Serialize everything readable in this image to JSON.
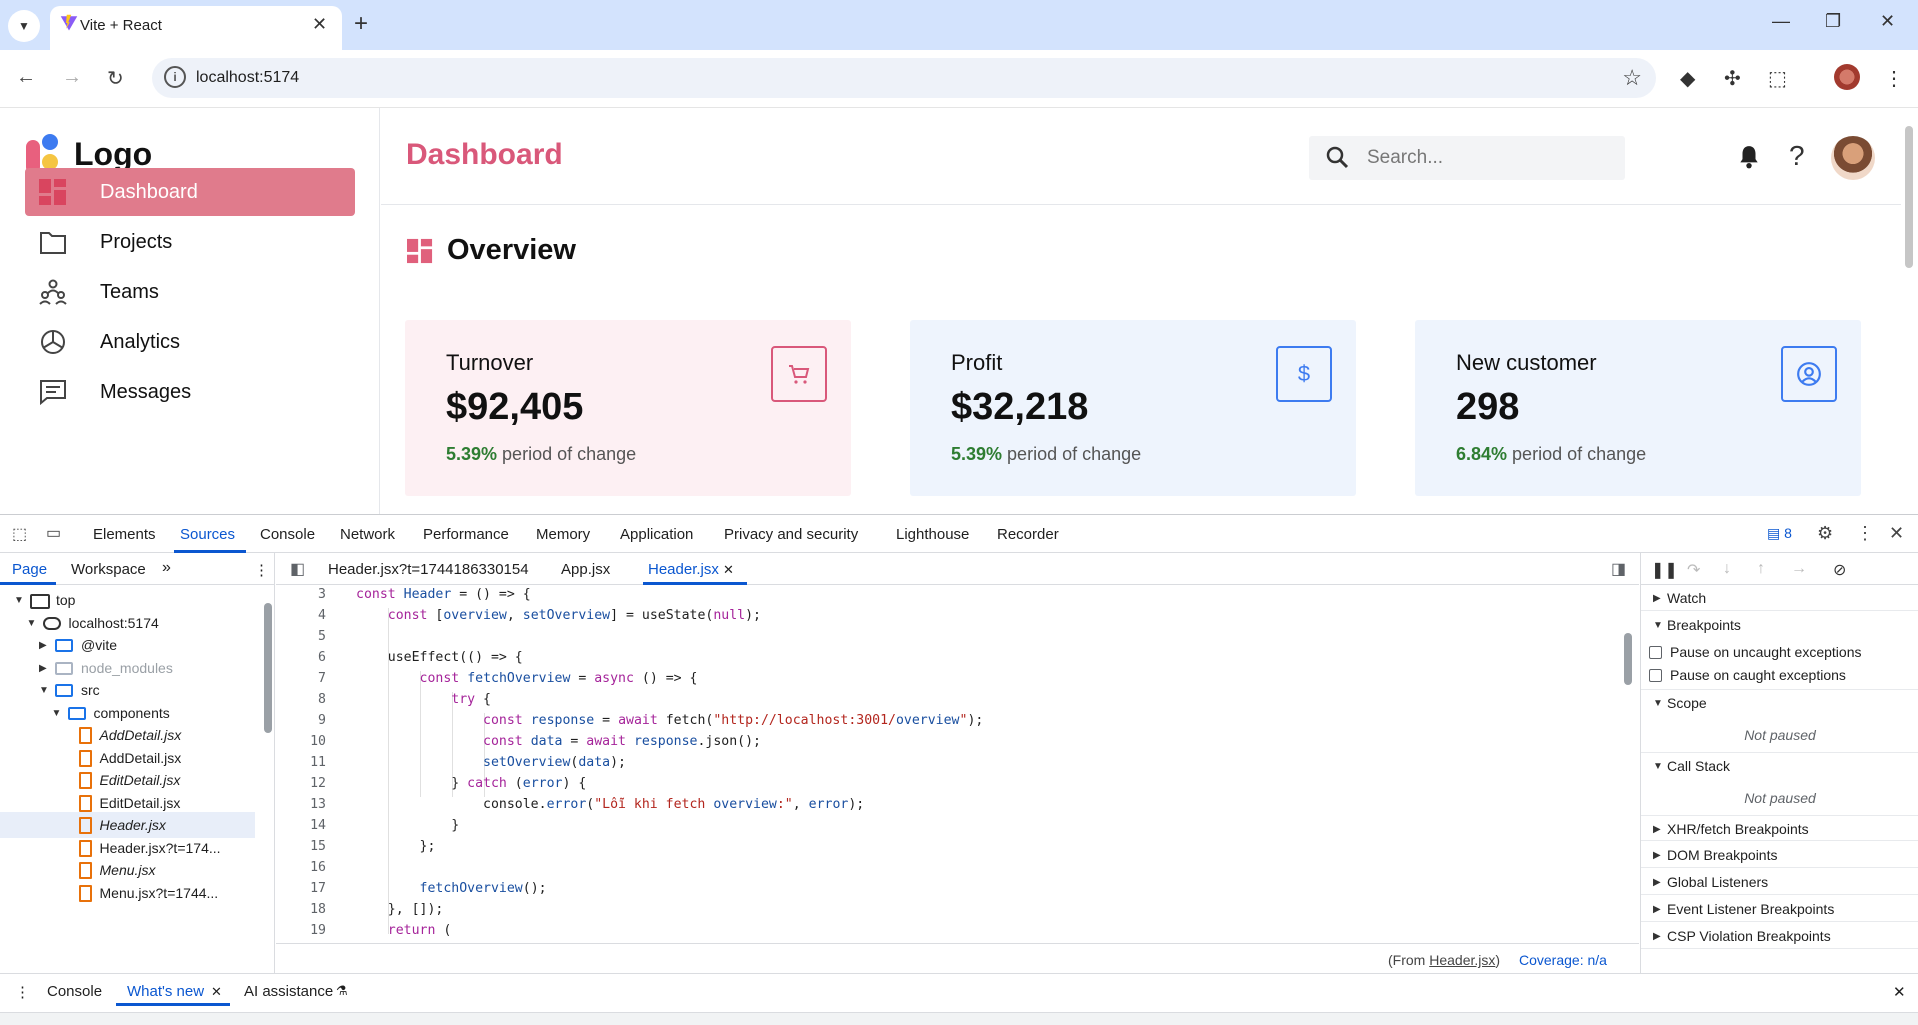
{
  "browser": {
    "tab_title": "Vite + React",
    "tab_close": "✕",
    "new_tab": "+",
    "url": "localhost:5174",
    "window_controls": [
      "—",
      "❐",
      "✕"
    ]
  },
  "app": {
    "logo_text": "Logo",
    "brand_colors": {
      "pink": "#e8607e",
      "blue": "#3d7bf0",
      "yellow": "#f5c542"
    },
    "sidebar": {
      "items": [
        {
          "label": "Dashboard",
          "icon": "dashboard-icon",
          "active": true
        },
        {
          "label": "Projects",
          "icon": "folder-icon",
          "active": false
        },
        {
          "label": "Teams",
          "icon": "teams-icon",
          "active": false
        },
        {
          "label": "Analytics",
          "icon": "pie-chart-icon",
          "active": false
        },
        {
          "label": "Messages",
          "icon": "message-icon",
          "active": false
        }
      ]
    },
    "header": {
      "title": "Dashboard",
      "search_placeholder": "Search...",
      "help": "?"
    },
    "overview": {
      "title": "Overview",
      "cards": [
        {
          "title": "Turnover",
          "value": "$92,405",
          "change_pct": "5.39%",
          "change_text": " period of change",
          "icon": "cart-icon",
          "bg": "#fdf0f3",
          "accent": "#d9587a"
        },
        {
          "title": "Profit",
          "value": "$32,218",
          "change_pct": "5.39%",
          "change_text": " period of change",
          "icon": "dollar-icon",
          "icon_glyph": "$",
          "bg": "#eef4fd",
          "accent": "#3d7bf0"
        },
        {
          "title": "New customer",
          "value": "298",
          "change_pct": "6.84%",
          "change_text": " period of change",
          "icon": "user-circle-icon",
          "bg": "#eef4fd",
          "accent": "#3d7bf0"
        }
      ]
    }
  },
  "devtools": {
    "tabs": [
      "Elements",
      "Sources",
      "Console",
      "Network",
      "Performance",
      "Memory",
      "Application",
      "Privacy and security",
      "Lighthouse",
      "Recorder"
    ],
    "active_tab": "Sources",
    "issues_count": "8",
    "navigator": {
      "tabs": [
        "Page",
        "Workspace"
      ],
      "more": "»",
      "tree": [
        {
          "label": "top",
          "type": "frame",
          "expanded": true
        },
        {
          "label": "localhost:5174",
          "type": "cloud",
          "expanded": true
        },
        {
          "label": "@vite",
          "type": "folder",
          "expanded": false
        },
        {
          "label": "node_modules",
          "type": "folder-grey",
          "expanded": false
        },
        {
          "label": "src",
          "type": "folder",
          "expanded": true
        },
        {
          "label": "components",
          "type": "folder",
          "expanded": true
        },
        {
          "label": "AddDetail.jsx",
          "type": "file",
          "italic": true
        },
        {
          "label": "AddDetail.jsx",
          "type": "file",
          "italic": false
        },
        {
          "label": "EditDetail.jsx",
          "type": "file",
          "italic": true
        },
        {
          "label": "EditDetail.jsx",
          "type": "file",
          "italic": false
        },
        {
          "label": "Header.jsx",
          "type": "file",
          "italic": true,
          "selected": true
        },
        {
          "label": "Header.jsx?t=174...",
          "type": "file",
          "italic": false
        },
        {
          "label": "Menu.jsx",
          "type": "file",
          "italic": true
        },
        {
          "label": "Menu.jsx?t=1744...",
          "type": "file",
          "italic": false
        }
      ]
    },
    "editor": {
      "tabs": [
        "Header.jsx?t=1744186330154",
        "App.jsx",
        "Header.jsx"
      ],
      "active_tab": "Header.jsx",
      "close": "✕",
      "lines": [
        {
          "n": "3",
          "code": "const Header = () => {"
        },
        {
          "n": "4",
          "code": "    const [overview, setOverview] = useState(null);"
        },
        {
          "n": "5",
          "code": ""
        },
        {
          "n": "6",
          "code": "    useEffect(() => {"
        },
        {
          "n": "7",
          "code": "        const fetchOverview = async () => {"
        },
        {
          "n": "8",
          "code": "            try {"
        },
        {
          "n": "9",
          "code": "                const response = await fetch(\"http://localhost:3001/overview\");"
        },
        {
          "n": "10",
          "code": "                const data = await response.json();"
        },
        {
          "n": "11",
          "code": "                setOverview(data);"
        },
        {
          "n": "12",
          "code": "            } catch (error) {"
        },
        {
          "n": "13",
          "code": "                console.error(\"Lỗi khi fetch overview:\", error);"
        },
        {
          "n": "14",
          "code": "            }"
        },
        {
          "n": "15",
          "code": "        };"
        },
        {
          "n": "16",
          "code": ""
        },
        {
          "n": "17",
          "code": "        fetchOverview();"
        },
        {
          "n": "18",
          "code": "    }, []);"
        },
        {
          "n": "19",
          "code": "    return ("
        }
      ],
      "footer_from_prefix": "(From ",
      "footer_from_file": "Header.jsx",
      "footer_from_suffix": ")",
      "coverage": "Coverage: n/a"
    },
    "debugger": {
      "sections": [
        {
          "label": "Watch",
          "expanded": false
        },
        {
          "label": "Breakpoints",
          "expanded": true
        },
        {
          "label": "Scope",
          "expanded": true
        },
        {
          "label": "Call Stack",
          "expanded": true
        },
        {
          "label": "XHR/fetch Breakpoints",
          "expanded": false
        },
        {
          "label": "DOM Breakpoints",
          "expanded": false
        },
        {
          "label": "Global Listeners",
          "expanded": false
        },
        {
          "label": "Event Listener Breakpoints",
          "expanded": false
        },
        {
          "label": "CSP Violation Breakpoints",
          "expanded": false
        }
      ],
      "pause_uncaught": "Pause on uncaught exceptions",
      "pause_caught": "Pause on caught exceptions",
      "not_paused": "Not paused"
    },
    "drawer": {
      "tabs": [
        "Console",
        "What's new",
        "AI assistance"
      ],
      "active_tab": "What's new",
      "close": "✕"
    }
  }
}
